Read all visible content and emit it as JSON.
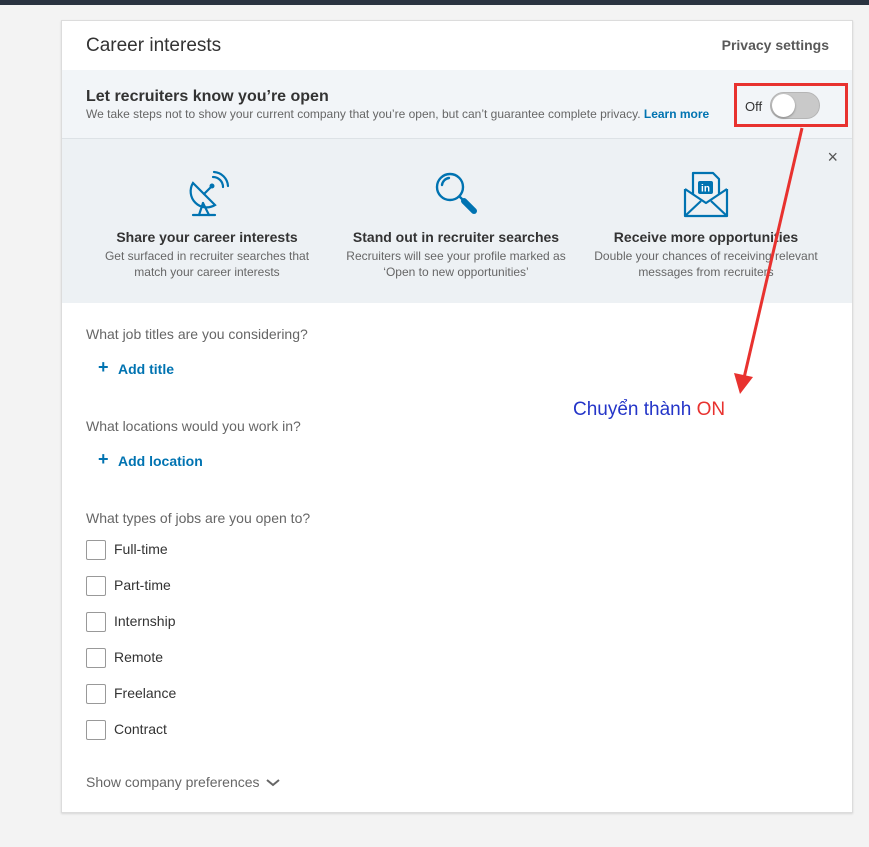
{
  "header": {
    "title": "Career interests",
    "privacy_link": "Privacy settings"
  },
  "open_to_recruiters": {
    "title": "Let recruiters know you’re open",
    "description": "We take steps not to show your current company that you’re open, but can’t guarantee complete privacy.",
    "learn_more": "Learn more",
    "toggle_label": "Off",
    "toggle_on": false
  },
  "promo": {
    "close": "×",
    "benefits": [
      {
        "icon": "satellite-dish-icon",
        "title": "Share your career interests",
        "desc_1": "Get surfaced in recruiter searches that",
        "desc_2": "match your career interests"
      },
      {
        "icon": "magnifier-icon",
        "title": "Stand out in recruiter searches",
        "desc_1": "Recruiters will see your profile marked as",
        "desc_2": "‘Open to new opportunities’"
      },
      {
        "icon": "linkedin-envelope-icon",
        "title": "Receive more opportunities",
        "desc_1": "Double your chances of receiving relevant",
        "desc_2": "messages from recruiters"
      }
    ]
  },
  "job_titles": {
    "question": "What job titles are you considering?",
    "add_label": "Add title"
  },
  "locations": {
    "question": "What locations would you work in?",
    "add_label": "Add location"
  },
  "job_types": {
    "question": "What types of jobs are you open to?",
    "options": [
      "Full-time",
      "Part-time",
      "Internship",
      "Remote",
      "Freelance",
      "Contract"
    ]
  },
  "show_company": "Show company preferences",
  "annotation": {
    "text_blue": "Chuyển thành",
    "text_red": "ON",
    "color_blue": "#2435c8",
    "color_red": "#e8322f"
  },
  "colors": {
    "link": "#0073b1",
    "icon": "#0073b1",
    "annotation_red": "#e8322f"
  }
}
